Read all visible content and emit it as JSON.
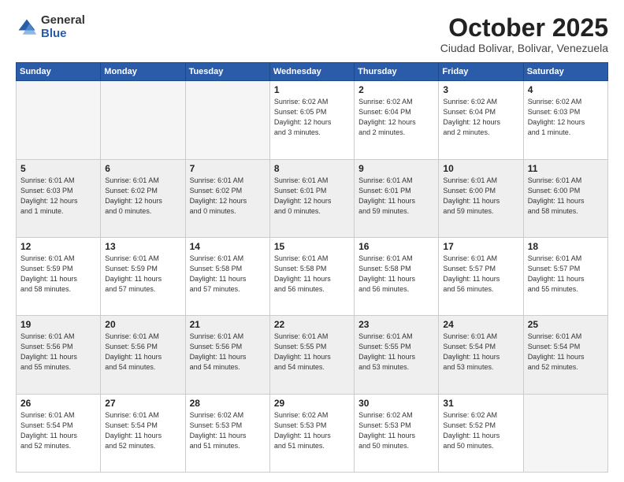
{
  "logo": {
    "general": "General",
    "blue": "Blue"
  },
  "header": {
    "month": "October 2025",
    "location": "Ciudad Bolivar, Bolivar, Venezuela"
  },
  "weekdays": [
    "Sunday",
    "Monday",
    "Tuesday",
    "Wednesday",
    "Thursday",
    "Friday",
    "Saturday"
  ],
  "weeks": [
    [
      {
        "day": "",
        "info": ""
      },
      {
        "day": "",
        "info": ""
      },
      {
        "day": "",
        "info": ""
      },
      {
        "day": "1",
        "info": "Sunrise: 6:02 AM\nSunset: 6:05 PM\nDaylight: 12 hours\nand 3 minutes."
      },
      {
        "day": "2",
        "info": "Sunrise: 6:02 AM\nSunset: 6:04 PM\nDaylight: 12 hours\nand 2 minutes."
      },
      {
        "day": "3",
        "info": "Sunrise: 6:02 AM\nSunset: 6:04 PM\nDaylight: 12 hours\nand 2 minutes."
      },
      {
        "day": "4",
        "info": "Sunrise: 6:02 AM\nSunset: 6:03 PM\nDaylight: 12 hours\nand 1 minute."
      }
    ],
    [
      {
        "day": "5",
        "info": "Sunrise: 6:01 AM\nSunset: 6:03 PM\nDaylight: 12 hours\nand 1 minute."
      },
      {
        "day": "6",
        "info": "Sunrise: 6:01 AM\nSunset: 6:02 PM\nDaylight: 12 hours\nand 0 minutes."
      },
      {
        "day": "7",
        "info": "Sunrise: 6:01 AM\nSunset: 6:02 PM\nDaylight: 12 hours\nand 0 minutes."
      },
      {
        "day": "8",
        "info": "Sunrise: 6:01 AM\nSunset: 6:01 PM\nDaylight: 12 hours\nand 0 minutes."
      },
      {
        "day": "9",
        "info": "Sunrise: 6:01 AM\nSunset: 6:01 PM\nDaylight: 11 hours\nand 59 minutes."
      },
      {
        "day": "10",
        "info": "Sunrise: 6:01 AM\nSunset: 6:00 PM\nDaylight: 11 hours\nand 59 minutes."
      },
      {
        "day": "11",
        "info": "Sunrise: 6:01 AM\nSunset: 6:00 PM\nDaylight: 11 hours\nand 58 minutes."
      }
    ],
    [
      {
        "day": "12",
        "info": "Sunrise: 6:01 AM\nSunset: 5:59 PM\nDaylight: 11 hours\nand 58 minutes."
      },
      {
        "day": "13",
        "info": "Sunrise: 6:01 AM\nSunset: 5:59 PM\nDaylight: 11 hours\nand 57 minutes."
      },
      {
        "day": "14",
        "info": "Sunrise: 6:01 AM\nSunset: 5:58 PM\nDaylight: 11 hours\nand 57 minutes."
      },
      {
        "day": "15",
        "info": "Sunrise: 6:01 AM\nSunset: 5:58 PM\nDaylight: 11 hours\nand 56 minutes."
      },
      {
        "day": "16",
        "info": "Sunrise: 6:01 AM\nSunset: 5:58 PM\nDaylight: 11 hours\nand 56 minutes."
      },
      {
        "day": "17",
        "info": "Sunrise: 6:01 AM\nSunset: 5:57 PM\nDaylight: 11 hours\nand 56 minutes."
      },
      {
        "day": "18",
        "info": "Sunrise: 6:01 AM\nSunset: 5:57 PM\nDaylight: 11 hours\nand 55 minutes."
      }
    ],
    [
      {
        "day": "19",
        "info": "Sunrise: 6:01 AM\nSunset: 5:56 PM\nDaylight: 11 hours\nand 55 minutes."
      },
      {
        "day": "20",
        "info": "Sunrise: 6:01 AM\nSunset: 5:56 PM\nDaylight: 11 hours\nand 54 minutes."
      },
      {
        "day": "21",
        "info": "Sunrise: 6:01 AM\nSunset: 5:56 PM\nDaylight: 11 hours\nand 54 minutes."
      },
      {
        "day": "22",
        "info": "Sunrise: 6:01 AM\nSunset: 5:55 PM\nDaylight: 11 hours\nand 54 minutes."
      },
      {
        "day": "23",
        "info": "Sunrise: 6:01 AM\nSunset: 5:55 PM\nDaylight: 11 hours\nand 53 minutes."
      },
      {
        "day": "24",
        "info": "Sunrise: 6:01 AM\nSunset: 5:54 PM\nDaylight: 11 hours\nand 53 minutes."
      },
      {
        "day": "25",
        "info": "Sunrise: 6:01 AM\nSunset: 5:54 PM\nDaylight: 11 hours\nand 52 minutes."
      }
    ],
    [
      {
        "day": "26",
        "info": "Sunrise: 6:01 AM\nSunset: 5:54 PM\nDaylight: 11 hours\nand 52 minutes."
      },
      {
        "day": "27",
        "info": "Sunrise: 6:01 AM\nSunset: 5:54 PM\nDaylight: 11 hours\nand 52 minutes."
      },
      {
        "day": "28",
        "info": "Sunrise: 6:02 AM\nSunset: 5:53 PM\nDaylight: 11 hours\nand 51 minutes."
      },
      {
        "day": "29",
        "info": "Sunrise: 6:02 AM\nSunset: 5:53 PM\nDaylight: 11 hours\nand 51 minutes."
      },
      {
        "day": "30",
        "info": "Sunrise: 6:02 AM\nSunset: 5:53 PM\nDaylight: 11 hours\nand 50 minutes."
      },
      {
        "day": "31",
        "info": "Sunrise: 6:02 AM\nSunset: 5:52 PM\nDaylight: 11 hours\nand 50 minutes."
      },
      {
        "day": "",
        "info": ""
      }
    ]
  ]
}
